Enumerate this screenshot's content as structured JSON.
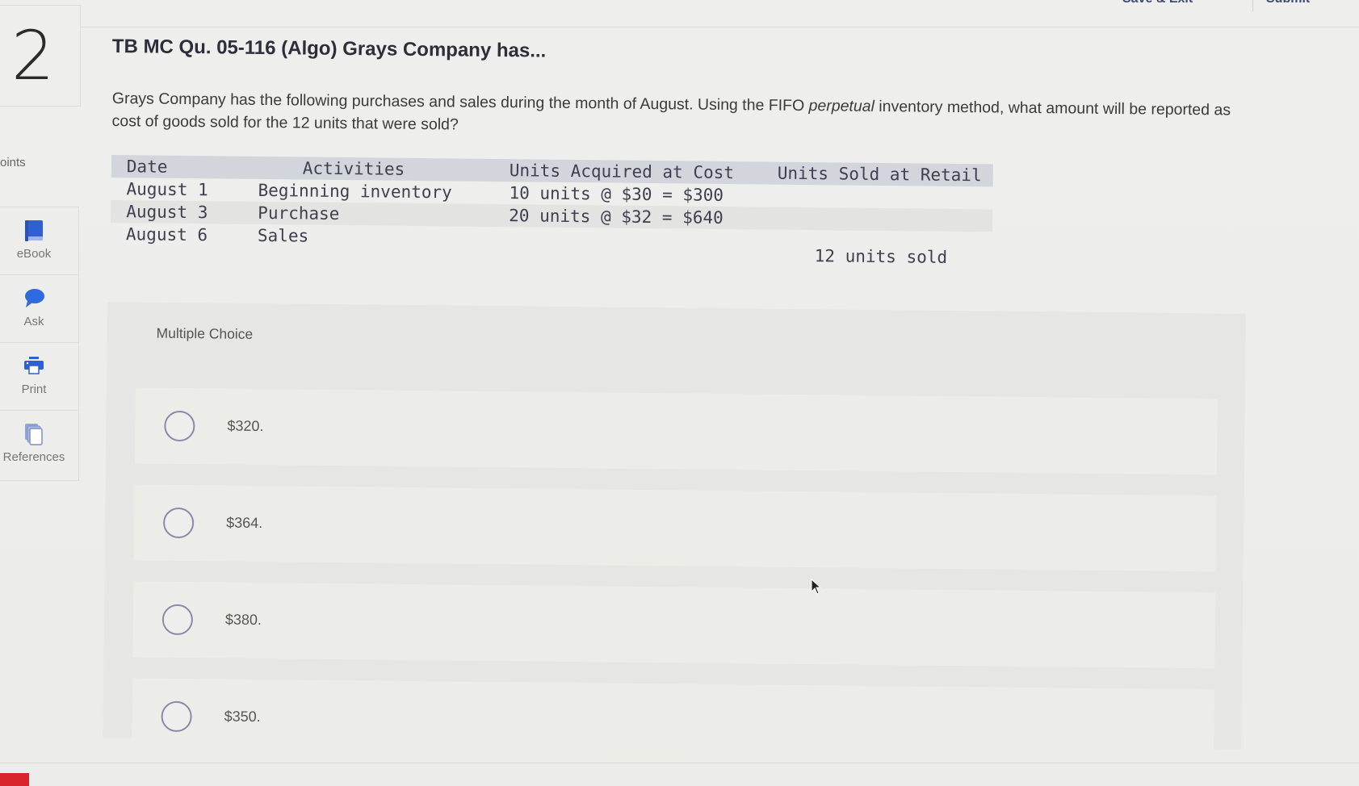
{
  "topbar": {
    "save_exit_label": "Save & Exit",
    "submit_label": "Submit"
  },
  "question": {
    "number": "2",
    "points_label": "oints",
    "title": "TB MC Qu. 05-116 (Algo) Grays Company has...",
    "prompt_part1": "Grays Company has the following purchases and sales during the month of August. Using the FIFO ",
    "prompt_em": "perpetual",
    "prompt_part2": " inventory method, what amount will be reported as cost of goods sold for the 12 units that were sold?"
  },
  "tools": [
    {
      "label": "eBook",
      "icon": "book-icon"
    },
    {
      "label": "Ask",
      "icon": "chat-bubble-icon"
    },
    {
      "label": "Print",
      "icon": "printer-icon"
    },
    {
      "label": "References",
      "icon": "documents-icon"
    }
  ],
  "table": {
    "headers": [
      "Date",
      "Activities",
      "Units Acquired at Cost",
      "Units Sold at Retail"
    ],
    "rows": [
      {
        "date": "August 1",
        "activity": "Beginning inventory",
        "acquired": "10 units @ $30 = $300",
        "sold": ""
      },
      {
        "date": "August 3",
        "activity": "Purchase",
        "acquired": "20 units @ $32 = $640",
        "sold": ""
      },
      {
        "date": "August 6",
        "activity": "Sales",
        "acquired": "",
        "sold": "12 units sold"
      }
    ]
  },
  "multiple_choice": {
    "label": "Multiple Choice",
    "options": [
      {
        "value": "$320.",
        "selected": false
      },
      {
        "value": "$364.",
        "selected": false
      },
      {
        "value": "$380.",
        "selected": false
      },
      {
        "value": "$350.",
        "selected": false
      }
    ]
  },
  "colors": {
    "accent_blue": "#2f5fd0",
    "radio_border": "#8a8aa8",
    "table_header_bg": "#d3d5dc",
    "brand_red": "#d8232a"
  }
}
